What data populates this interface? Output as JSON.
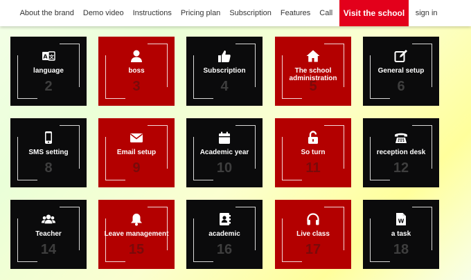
{
  "nav": {
    "items": [
      "About the brand",
      "Demo video",
      "Instructions",
      "Pricing plan",
      "Subscription",
      "Features",
      "Call"
    ],
    "cta": "Visit the school",
    "signin": "sign in",
    "cta_color": "#e3001b"
  },
  "tiles": [
    {
      "label": "language",
      "number": "2",
      "icon": "translate-icon",
      "theme": "dark"
    },
    {
      "label": "boss",
      "number": "3",
      "icon": "user-icon",
      "theme": "red"
    },
    {
      "label": "Subscription",
      "number": "4",
      "icon": "thumbs-up-icon",
      "theme": "dark"
    },
    {
      "label": "The school administration",
      "number": "5",
      "icon": "home-icon",
      "theme": "red"
    },
    {
      "label": "General setup",
      "number": "6",
      "icon": "edit-icon",
      "theme": "dark"
    },
    {
      "label": "SMS setting",
      "number": "8",
      "icon": "mobile-icon",
      "theme": "dark"
    },
    {
      "label": "Email setup",
      "number": "9",
      "icon": "envelope-icon",
      "theme": "red"
    },
    {
      "label": "Academic year",
      "number": "10",
      "icon": "calendar-icon",
      "theme": "dark"
    },
    {
      "label": "So turn",
      "number": "11",
      "icon": "unlock-icon",
      "theme": "red"
    },
    {
      "label": "reception desk",
      "number": "12",
      "icon": "telephone-icon",
      "theme": "dark"
    },
    {
      "label": "Teacher",
      "number": "14",
      "icon": "users-icon",
      "theme": "dark"
    },
    {
      "label": "Leave management",
      "number": "15",
      "icon": "bell-icon",
      "theme": "red"
    },
    {
      "label": "academic",
      "number": "16",
      "icon": "address-book-icon",
      "theme": "dark"
    },
    {
      "label": "Live class",
      "number": "17",
      "icon": "headphones-icon",
      "theme": "red"
    },
    {
      "label": "a task",
      "number": "18",
      "icon": "word-file-icon",
      "theme": "dark"
    }
  ]
}
